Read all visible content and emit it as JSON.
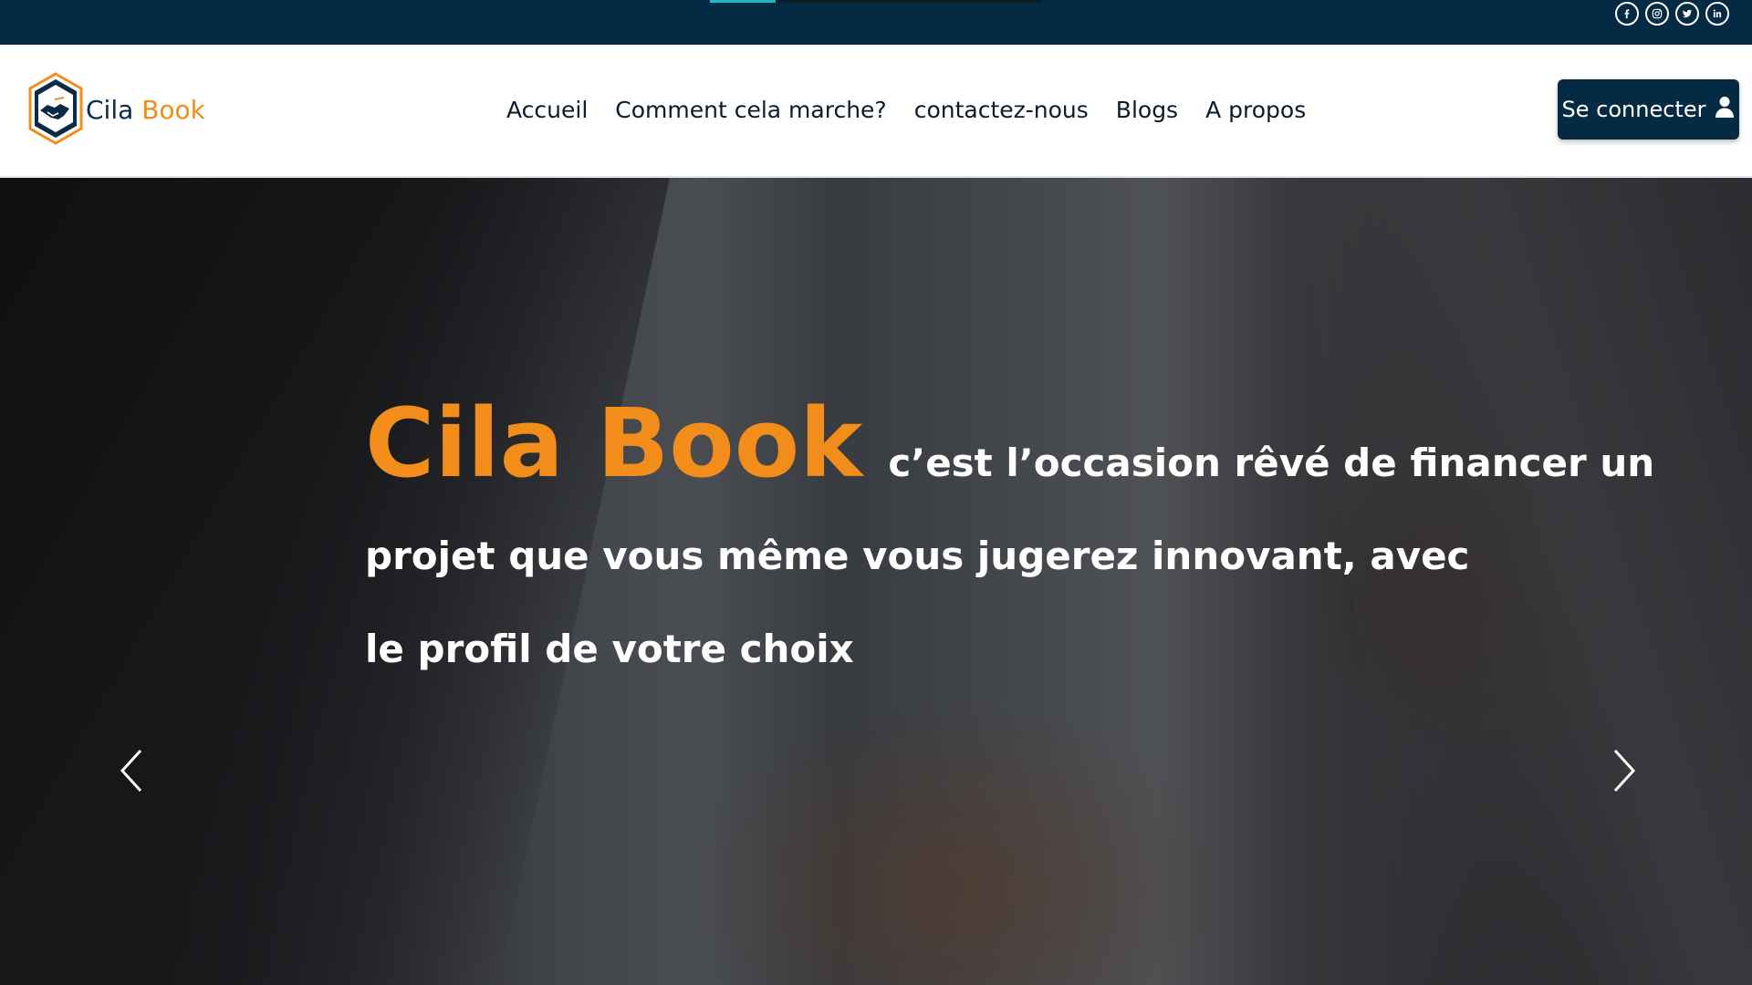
{
  "social": [
    {
      "name": "facebook",
      "icon": "facebook-icon"
    },
    {
      "name": "instagram",
      "icon": "instagram-icon"
    },
    {
      "name": "twitter",
      "icon": "twitter-icon"
    },
    {
      "name": "linkedin",
      "icon": "linkedin-icon"
    }
  ],
  "logo": {
    "word1": "Cila",
    "word2": "Book"
  },
  "nav": {
    "items": [
      {
        "label": "Accueil"
      },
      {
        "label": "Comment cela marche?"
      },
      {
        "label": "contactez-nous"
      },
      {
        "label": "Blogs"
      },
      {
        "label": "A propos"
      }
    ]
  },
  "header": {
    "login_label": "Se connecter"
  },
  "hero": {
    "brand": "Cila Book",
    "line1": "c’est l’occasion rêvé de financer un",
    "line2": "projet que vous même vous jugerez innovant, avec",
    "line3": "le profil de votre choix"
  },
  "colors": {
    "brand_navy": "#052a44",
    "brand_orange": "#f28c1a",
    "topbar_active": "#1fb6c9"
  }
}
